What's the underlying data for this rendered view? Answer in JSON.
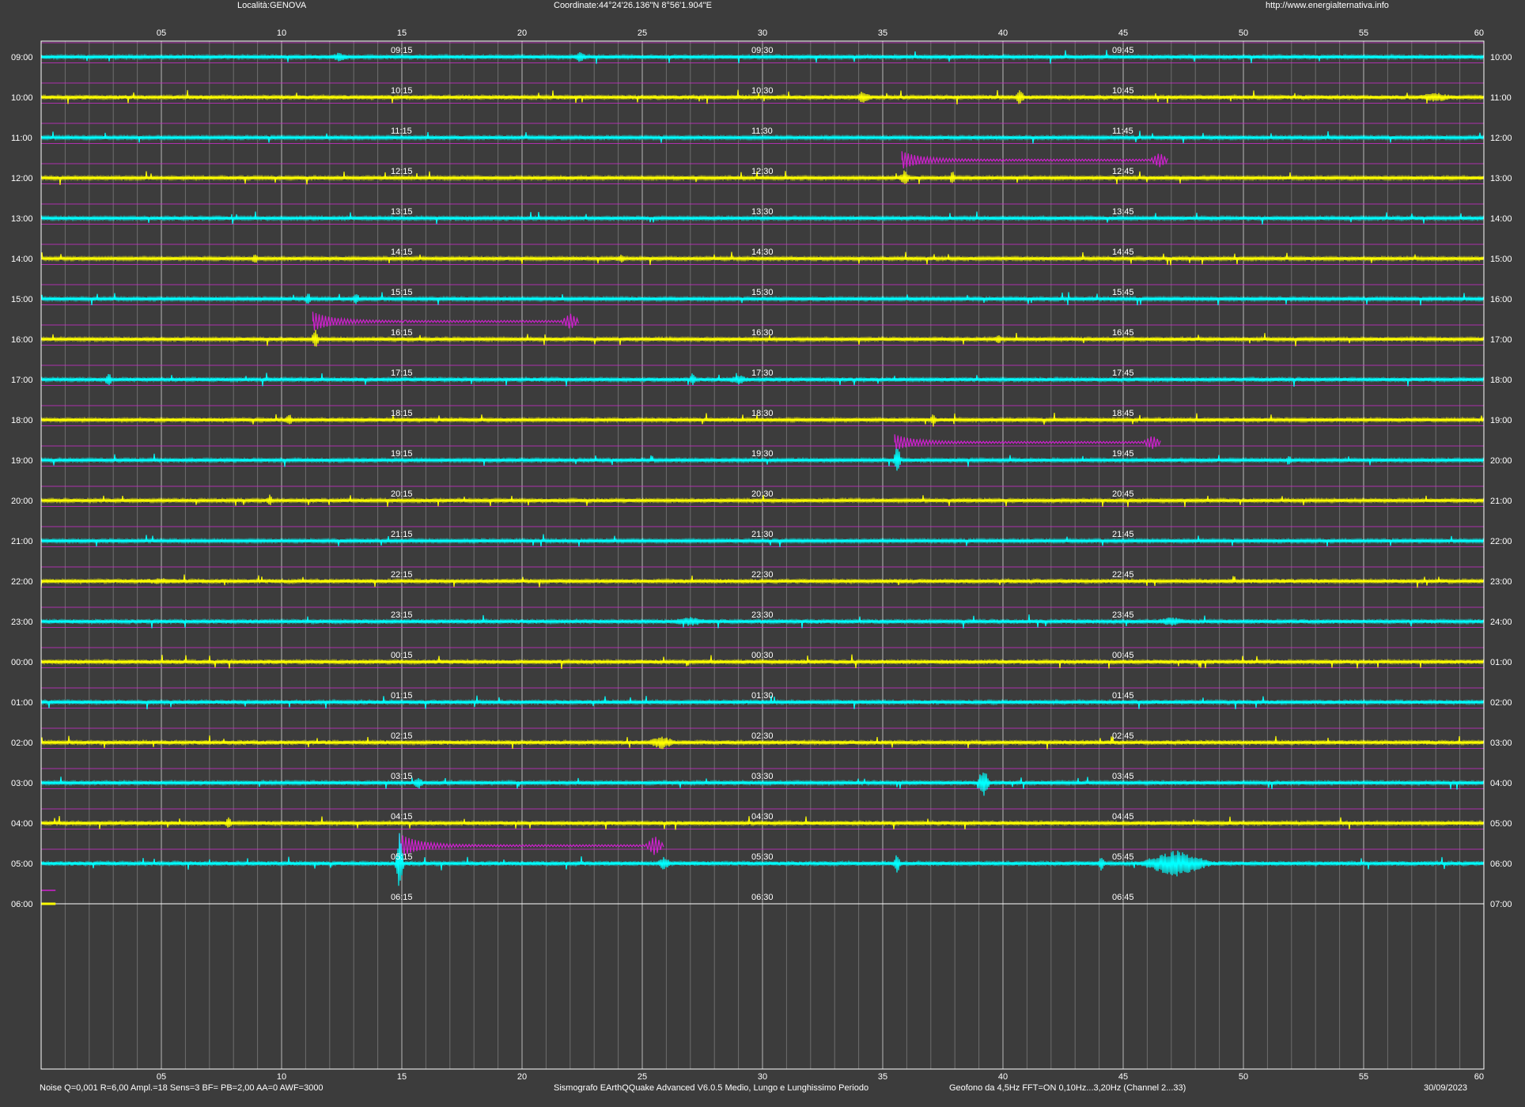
{
  "header": {
    "location": "Località:GENOVA",
    "coordinates": "Coordinate:44°24'26.136\"N  8°56'1.904\"E",
    "website": "http://www.energialternativa.info"
  },
  "footer": {
    "params": "Noise Q=0,001 R=6,00 Ampl.=18 Sens=3 BF= PB=2,00 AA=0 AWF=3000",
    "software": "Sismografo  EArthQQuake Advanced V6.0.5  Medio, Lungo e Lunghissimo Periodo",
    "sensor": "Geofono da 4,5Hz FFT=ON 0,10Hz...3,20Hz     (Channel 2...33)",
    "date": "30/09/2023"
  },
  "colors": {
    "background": "#3c3c3c",
    "trace_cyan": "#00ffff",
    "trace_yellow": "#ffff00",
    "event_magenta": "#d020d0",
    "grid_major": "#b8b8b8",
    "grid_minor": "#6e6e6e",
    "separator": "#c030c0"
  },
  "chart_data": {
    "type": "line",
    "xlim": [
      0,
      60
    ],
    "x_unit": "minutes",
    "x_ticks": [
      "05",
      "10",
      "15",
      "20",
      "25",
      "30",
      "35",
      "40",
      "45",
      "50",
      "55",
      "60"
    ],
    "grid": true,
    "rows": [
      {
        "start": "09:00",
        "end": "10:00",
        "marks": [
          "09:15",
          "09:30",
          "09:45"
        ],
        "color": "cyan",
        "noise": 0.45
      },
      {
        "start": "10:00",
        "end": "11:00",
        "marks": [
          "10:15",
          "10:30",
          "10:45"
        ],
        "color": "yellow",
        "noise": 0.55
      },
      {
        "start": "11:00",
        "end": "12:00",
        "marks": [
          "11:15",
          "11:30",
          "11:45"
        ],
        "color": "cyan",
        "noise": 0.35
      },
      {
        "start": "12:00",
        "end": "13:00",
        "marks": [
          "12:15",
          "12:30",
          "12:45"
        ],
        "color": "yellow",
        "noise": 0.4
      },
      {
        "start": "13:00",
        "end": "14:00",
        "marks": [
          "13:15",
          "13:30",
          "13:45"
        ],
        "color": "cyan",
        "noise": 0.4
      },
      {
        "start": "14:00",
        "end": "15:00",
        "marks": [
          "14:15",
          "14:30",
          "14:45"
        ],
        "color": "yellow",
        "noise": 0.4
      },
      {
        "start": "15:00",
        "end": "16:00",
        "marks": [
          "15:15",
          "15:30",
          "15:45"
        ],
        "color": "cyan",
        "noise": 0.35
      },
      {
        "start": "16:00",
        "end": "17:00",
        "marks": [
          "16:15",
          "16:30",
          "16:45"
        ],
        "color": "yellow",
        "noise": 0.45
      },
      {
        "start": "17:00",
        "end": "18:00",
        "marks": [
          "17:15",
          "17:30",
          "17:45"
        ],
        "color": "cyan",
        "noise": 0.5
      },
      {
        "start": "18:00",
        "end": "19:00",
        "marks": [
          "18:15",
          "18:30",
          "18:45"
        ],
        "color": "yellow",
        "noise": 0.45
      },
      {
        "start": "19:00",
        "end": "20:00",
        "marks": [
          "19:15",
          "19:30",
          "19:45"
        ],
        "color": "cyan",
        "noise": 0.4
      },
      {
        "start": "20:00",
        "end": "21:00",
        "marks": [
          "20:15",
          "20:30",
          "20:45"
        ],
        "color": "yellow",
        "noise": 0.45
      },
      {
        "start": "21:00",
        "end": "22:00",
        "marks": [
          "21:15",
          "21:30",
          "21:45"
        ],
        "color": "cyan",
        "noise": 0.35
      },
      {
        "start": "22:00",
        "end": "23:00",
        "marks": [
          "22:15",
          "22:30",
          "22:45"
        ],
        "color": "yellow",
        "noise": 0.55
      },
      {
        "start": "23:00",
        "end": "24:00",
        "marks": [
          "23:15",
          "23:30",
          "23:45"
        ],
        "color": "cyan",
        "noise": 0.55
      },
      {
        "start": "00:00",
        "end": "01:00",
        "marks": [
          "00:15",
          "00:30",
          "00:45"
        ],
        "color": "yellow",
        "noise": 0.55
      },
      {
        "start": "01:00",
        "end": "02:00",
        "marks": [
          "01:15",
          "01:30",
          "01:45"
        ],
        "color": "cyan",
        "noise": 0.5
      },
      {
        "start": "02:00",
        "end": "03:00",
        "marks": [
          "02:15",
          "02:30",
          "02:45"
        ],
        "color": "yellow",
        "noise": 0.55
      },
      {
        "start": "03:00",
        "end": "04:00",
        "marks": [
          "03:15",
          "03:30",
          "03:45"
        ],
        "color": "cyan",
        "noise": 0.45
      },
      {
        "start": "04:00",
        "end": "05:00",
        "marks": [
          "04:15",
          "04:30",
          "04:45"
        ],
        "color": "yellow",
        "noise": 0.5
      },
      {
        "start": "05:00",
        "end": "06:00",
        "marks": [
          "05:15",
          "05:30",
          "05:45"
        ],
        "color": "cyan",
        "noise": 0.55
      },
      {
        "start": "06:00",
        "end": "07:00",
        "marks": [
          "06:15",
          "06:30",
          "06:45"
        ],
        "color": "none",
        "noise": 0,
        "recorded_until_minute": 0.6
      }
    ],
    "bursts": [
      {
        "row": 0,
        "minute": 12.4,
        "amp": 6,
        "width": 0.6
      },
      {
        "row": 0,
        "minute": 22.4,
        "amp": 7,
        "width": 0.4
      },
      {
        "row": 1,
        "minute": 34.2,
        "amp": 9,
        "width": 0.4
      },
      {
        "row": 1,
        "minute": 40.7,
        "amp": 10,
        "width": 0.3
      },
      {
        "row": 1,
        "minute": 58.0,
        "amp": 6,
        "width": 1.2
      },
      {
        "row": 3,
        "minute": 35.9,
        "amp": 10,
        "width": 0.3
      },
      {
        "row": 3,
        "minute": 37.9,
        "amp": 9,
        "width": 0.2
      },
      {
        "row": 5,
        "minute": 8.9,
        "amp": 8,
        "width": 0.2
      },
      {
        "row": 5,
        "minute": 24.1,
        "amp": 6,
        "width": 0.3
      },
      {
        "row": 6,
        "minute": 11.1,
        "amp": 9,
        "width": 0.2
      },
      {
        "row": 6,
        "minute": 13.1,
        "amp": 9,
        "width": 0.2
      },
      {
        "row": 7,
        "minute": 11.4,
        "amp": 14,
        "width": 0.2
      },
      {
        "row": 7,
        "minute": 39.8,
        "amp": 6,
        "width": 0.3
      },
      {
        "row": 8,
        "minute": 2.8,
        "amp": 10,
        "width": 0.2
      },
      {
        "row": 8,
        "minute": 27.1,
        "amp": 9,
        "width": 0.2
      },
      {
        "row": 8,
        "minute": 29.0,
        "amp": 7,
        "width": 0.6
      },
      {
        "row": 9,
        "minute": 10.3,
        "amp": 8,
        "width": 0.3
      },
      {
        "row": 9,
        "minute": 37.1,
        "amp": 9,
        "width": 0.2
      },
      {
        "row": 10,
        "minute": 35.6,
        "amp": 20,
        "width": 0.2
      },
      {
        "row": 10,
        "minute": 51.9,
        "amp": 8,
        "width": 0.2
      },
      {
        "row": 11,
        "minute": 9.5,
        "amp": 8,
        "width": 0.2
      },
      {
        "row": 13,
        "minute": 5.0,
        "amp": 4,
        "width": 2.0
      },
      {
        "row": 14,
        "minute": 27.0,
        "amp": 6,
        "width": 1.2
      },
      {
        "row": 14,
        "minute": 47.0,
        "amp": 6,
        "width": 1.0
      },
      {
        "row": 17,
        "minute": 25.8,
        "amp": 9,
        "width": 0.8
      },
      {
        "row": 18,
        "minute": 15.7,
        "amp": 8,
        "width": 0.3
      },
      {
        "row": 18,
        "minute": 39.2,
        "amp": 22,
        "width": 0.3
      },
      {
        "row": 19,
        "minute": 7.8,
        "amp": 8,
        "width": 0.2
      },
      {
        "row": 20,
        "minute": 14.9,
        "amp": 40,
        "width": 0.2
      },
      {
        "row": 20,
        "minute": 25.9,
        "amp": 9,
        "width": 0.4
      },
      {
        "row": 20,
        "minute": 35.6,
        "amp": 13,
        "width": 0.2
      },
      {
        "row": 20,
        "minute": 44.1,
        "amp": 11,
        "width": 0.2
      },
      {
        "row": 20,
        "minute": 47.2,
        "amp": 17,
        "width": 1.8
      }
    ],
    "events": [
      {
        "gap_after_row": 2,
        "start_minute": 35.8,
        "end_minute": 46.9,
        "amp": 10
      },
      {
        "gap_after_row": 6,
        "start_minute": 11.3,
        "end_minute": 22.4,
        "amp": 11
      },
      {
        "gap_after_row": 9,
        "start_minute": 35.5,
        "end_minute": 46.6,
        "amp": 9
      },
      {
        "gap_after_row": 19,
        "start_minute": 14.9,
        "end_minute": 25.9,
        "amp": 14
      }
    ]
  }
}
